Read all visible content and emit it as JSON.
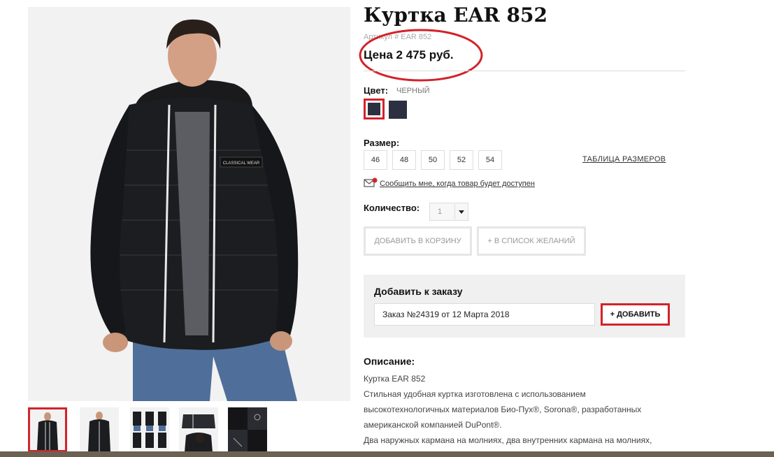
{
  "product": {
    "title": "Куртка EAR 852",
    "sku": "Артикул # EAR 852",
    "price": "Цена 2 475 руб."
  },
  "color": {
    "label": "Цвет:",
    "value": "ЧЕРНЫЙ",
    "swatches": [
      "#2d3040",
      "#2d3040"
    ]
  },
  "size": {
    "label": "Размер:",
    "options": [
      "46",
      "48",
      "50",
      "52",
      "54"
    ],
    "table_link": "ТАБЛИЦА РАЗМЕРОВ"
  },
  "notify": {
    "text": "Сообщить мне, когда товар будет доступен"
  },
  "quantity": {
    "label": "Количество:",
    "value": "1"
  },
  "actions": {
    "add_to_cart": "ДОБАВИТЬ В КОРЗИНУ",
    "wishlist": "+ В СПИСОК ЖЕЛАНИЙ"
  },
  "order": {
    "title": "Добавить к заказу",
    "selected": "Заказ №24319 от 12 Марта 2018",
    "add_button": "+ ДОБАВИТЬ"
  },
  "description": {
    "title": "Описание:",
    "lines": [
      "Куртка EAR 852",
      "Стильная удобная куртка изготовлена с использованием",
      "высокотехнологичных материалов Био-Пух®, Sorona®, разработанных",
      "американской компанией DuPont®.",
      "Два наружных кармана на молниях, два внутренних кармана на молниях,"
    ]
  },
  "gallery": {
    "main_logo": "CLASSICAL WEAR",
    "thumbnails": 5
  },
  "colors": {
    "accent": "#d3222a",
    "jacket": "#1c1d20",
    "panel": "#f0f0f0"
  }
}
